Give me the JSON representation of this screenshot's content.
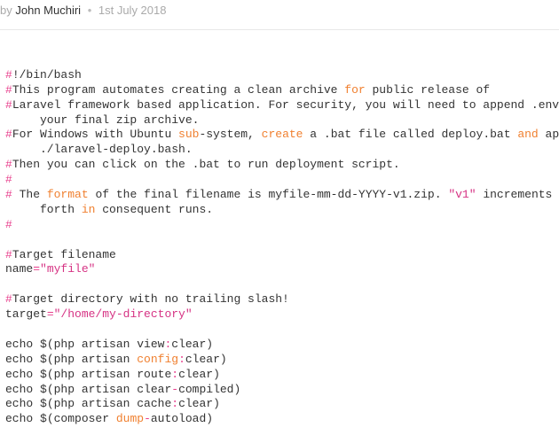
{
  "meta": {
    "by": "by",
    "author": "John Muchiri",
    "dot": "•",
    "date": "1st July 2018"
  },
  "code": {
    "l1a": "#",
    "l1b": "!/bin/bash",
    "l2a": "#",
    "l2b": "This program automates creating a clean archive ",
    "l2c": "for",
    "l2d": " public release of",
    "l3a": "#",
    "l3b": "Laravel framework based application. For security, you will need to append .env",
    "l3c": "     your final zip archive.",
    "l4a": "#",
    "l4b": "For Windows with Ubuntu ",
    "l4c": "sub",
    "l4d": "-system, ",
    "l4e": "create",
    "l4f": " a .bat file called deploy.bat ",
    "l4g": "and",
    "l4h": " ap",
    "l4i": "     ./laravel-deploy.bash.",
    "l5a": "#",
    "l5b": "Then you can click on the .bat to run deployment script.",
    "l6a": "#",
    "l7a": "#",
    "l7b": " The ",
    "l7c": "format",
    "l7d": " of the final filename is myfile-mm-dd-YYYY-v1.zip. ",
    "l7e": "\"v1\"",
    "l7f": " increments ",
    "l7g": "     forth ",
    "l7h": "in",
    "l7i": " consequent runs.",
    "l8a": "#",
    "l9a": "#",
    "l9b": "Target filename",
    "l10a": "name",
    "l10b": "=",
    "l10c": "\"myfile\"",
    "l11a": "#",
    "l11b": "Target directory with no trailing slash!",
    "l12a": "target",
    "l12b": "=",
    "l12c": "\"/home/my-directory\"",
    "l13a": "echo",
    "l13b": " $(php artisan view",
    "l13c": ":",
    "l13d": "clear)",
    "l14a": "echo",
    "l14b": " $(php artisan ",
    "l14c": "config",
    "l14d": ":",
    "l14e": "clear)",
    "l15a": "echo",
    "l15b": " $(php artisan route",
    "l15c": ":",
    "l15d": "clear)",
    "l16a": "echo",
    "l16b": " $(php artisan clear",
    "l16c": "-",
    "l16d": "compiled)",
    "l17a": "echo",
    "l17b": " $(php artisan cache",
    "l17c": ":",
    "l17d": "clear)",
    "l18a": "echo",
    "l18b": " $(composer ",
    "l18c": "dump",
    "l18d": "-",
    "l18e": "autoload)"
  }
}
